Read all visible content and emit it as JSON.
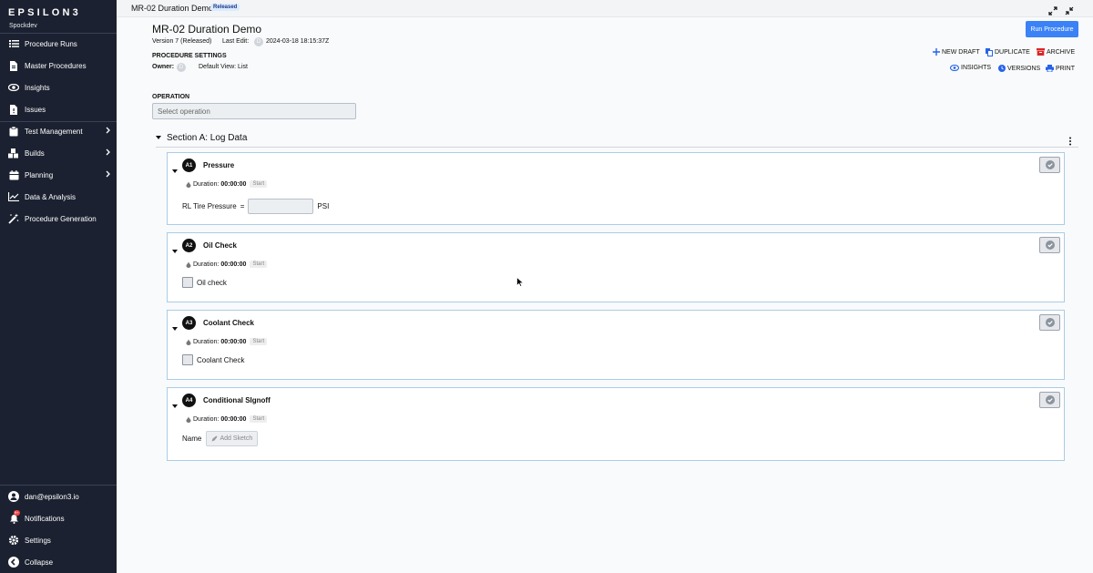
{
  "sidebar": {
    "logo": "EPSILON3",
    "workspace": "Spockdev",
    "items": [
      {
        "label": "Procedure Runs",
        "icon": "list-icon"
      },
      {
        "label": "Master Procedures",
        "icon": "document-icon"
      },
      {
        "label": "Insights",
        "icon": "eye-icon"
      },
      {
        "label": "Issues",
        "icon": "issue-icon"
      },
      {
        "label": "Test Management",
        "icon": "clipboard-icon"
      },
      {
        "label": "Builds",
        "icon": "cubes-icon"
      },
      {
        "label": "Planning",
        "icon": "calendar-icon"
      },
      {
        "label": "Data & Analysis",
        "icon": "chart-line-icon"
      },
      {
        "label": "Procedure Generation",
        "icon": "magic-wand-icon"
      }
    ],
    "footer": [
      {
        "label": "dan@epsilon3.io",
        "icon": "user-icon"
      },
      {
        "label": "Notifications",
        "icon": "bell-icon",
        "badge": "9+"
      },
      {
        "label": "Settings",
        "icon": "gear-icon"
      },
      {
        "label": "Collapse",
        "icon": "chevron-left-icon"
      }
    ]
  },
  "topbar": {
    "title": "MR-02 Duration Demo",
    "badge": "Released"
  },
  "header": {
    "title": "MR-02 Duration Demo",
    "version": "Version 7 (Released)",
    "last_edit_label": "Last Edit:",
    "last_edit_avatar": "D",
    "last_edit_value": "2024-03-18 18:15:37Z",
    "settings_label": "PROCEDURE SETTINGS",
    "owner_label": "Owner:",
    "owner_avatar": "D",
    "default_view": "Default View: List",
    "run_button": "Run Procedure",
    "actions": {
      "new_draft": "NEW DRAFT",
      "duplicate": "DUPLICATE",
      "archive": "ARCHIVE",
      "insights": "INSIGHTS",
      "versions": "VERSIONS",
      "print": "PRINT"
    }
  },
  "operation": {
    "label": "OPERATION",
    "placeholder": "Select operation"
  },
  "section": {
    "title": "Section A: Log Data",
    "steps": [
      {
        "num": "A1",
        "title": "Pressure",
        "duration_label": "Duration:",
        "duration": "00:00:00",
        "start": "Start",
        "field_label": "RL Tire Pressure",
        "field_eq": "=",
        "field_unit": "PSI"
      },
      {
        "num": "A2",
        "title": "Oil Check",
        "duration_label": "Duration:",
        "duration": "00:00:00",
        "start": "Start",
        "checkbox_label": "Oil check"
      },
      {
        "num": "A3",
        "title": "Coolant Check",
        "duration_label": "Duration:",
        "duration": "00:00:00",
        "start": "Start",
        "checkbox_label": "Coolant Check"
      },
      {
        "num": "A4",
        "title": "Conditional SIgnoff",
        "duration_label": "Duration:",
        "duration": "00:00:00",
        "start": "Start",
        "field_label": "Name",
        "sketch_button": "Add Sketch"
      }
    ]
  },
  "colors": {
    "sidebar_bg": "#1b2130",
    "accent": "#3b82f6",
    "card_border": "#a9cde6"
  }
}
